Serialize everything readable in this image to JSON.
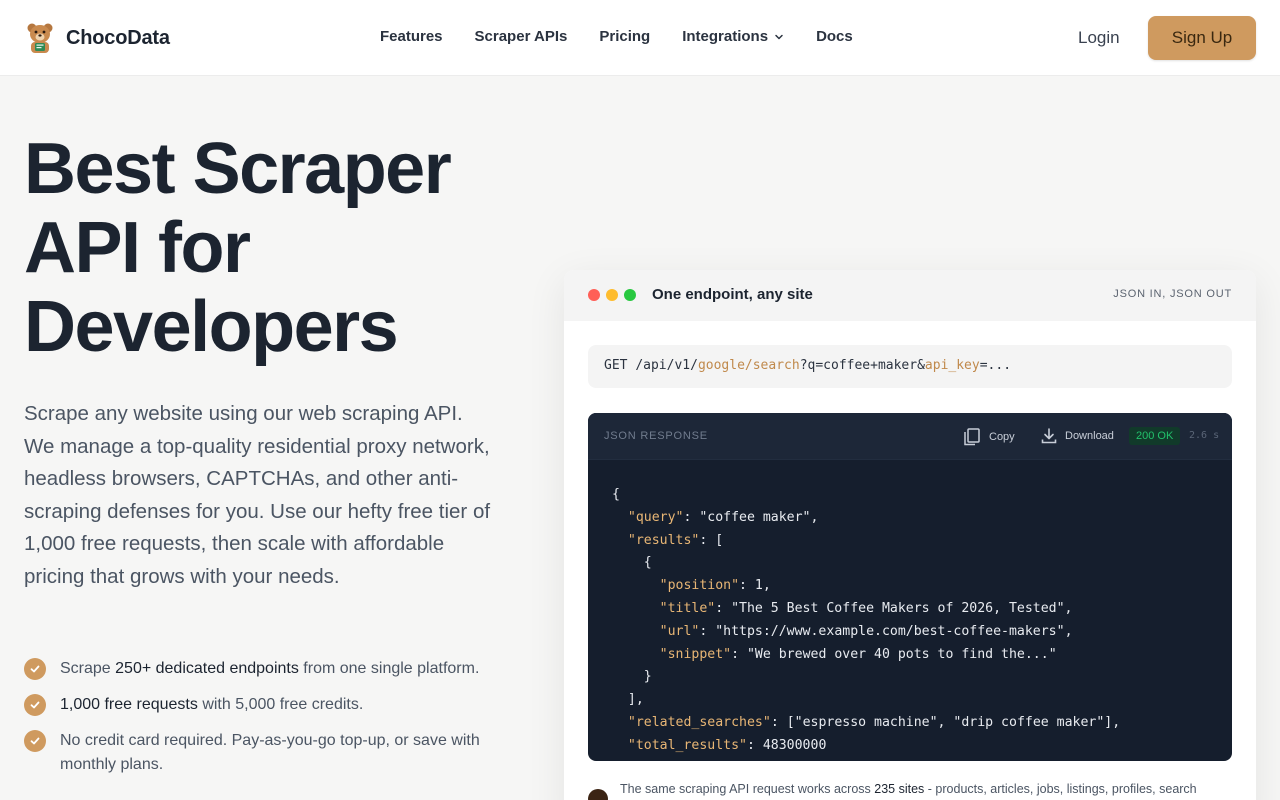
{
  "brand": {
    "name": "ChocoData",
    "logo_icon": "bear-mascot-icon"
  },
  "nav": {
    "items": [
      {
        "label": "Features"
      },
      {
        "label": "Scraper APIs"
      },
      {
        "label": "Pricing"
      },
      {
        "label": "Integrations",
        "has_dropdown": true
      },
      {
        "label": "Docs"
      }
    ],
    "login_label": "Login",
    "signup_label": "Sign Up"
  },
  "hero": {
    "title": "Best Scraper API for Developers",
    "description": "Scrape any website using our web scraping API. We manage a top-quality residential proxy network, headless browsers, CAPTCHAs, and other anti-scraping defenses for you. Use our hefty free tier of 1,000 free requests, then scale with affordable pricing that grows with your needs.",
    "features": [
      {
        "pre": "Scrape ",
        "bold": "250+ dedicated endpoints",
        "post": " from one single platform."
      },
      {
        "pre": "",
        "bold": "1,000 free requests",
        "post": " with 5,000 free credits."
      },
      {
        "pre": "No credit card required. Pay-as-you-go top-up, or save with monthly plans.",
        "bold": "",
        "post": ""
      }
    ]
  },
  "demo": {
    "title": "One endpoint, any site",
    "tag": "JSON IN, JSON OUT",
    "request": {
      "method": "GET",
      "path_prefix": "/api/v1/",
      "path_accent": "google/search",
      "query_prefix": "?q=coffee+maker&",
      "query_accent": "api_key",
      "query_suffix": "=..."
    },
    "response": {
      "label": "JSON RESPONSE",
      "copy_label": "Copy",
      "download_label": "Download",
      "status": "200 OK",
      "timing": "2.6 s",
      "lines": [
        [
          {
            "t": "{",
            "c": "s"
          }
        ],
        [
          {
            "t": "  ",
            "c": "s"
          },
          {
            "t": "\"query\"",
            "c": "k"
          },
          {
            "t": ": \"coffee maker\",",
            "c": "s"
          }
        ],
        [
          {
            "t": "  ",
            "c": "s"
          },
          {
            "t": "\"results\"",
            "c": "k"
          },
          {
            "t": ": [",
            "c": "s"
          }
        ],
        [
          {
            "t": "    {",
            "c": "s"
          }
        ],
        [
          {
            "t": "      ",
            "c": "s"
          },
          {
            "t": "\"position\"",
            "c": "k"
          },
          {
            "t": ": 1,",
            "c": "s"
          }
        ],
        [
          {
            "t": "      ",
            "c": "s"
          },
          {
            "t": "\"title\"",
            "c": "k"
          },
          {
            "t": ": \"The 5 Best Coffee Makers of 2026, Tested\",",
            "c": "s"
          }
        ],
        [
          {
            "t": "      ",
            "c": "s"
          },
          {
            "t": "\"url\"",
            "c": "k"
          },
          {
            "t": ": \"https://www.example.com/best-coffee-makers\",",
            "c": "s"
          }
        ],
        [
          {
            "t": "      ",
            "c": "s"
          },
          {
            "t": "\"snippet\"",
            "c": "k"
          },
          {
            "t": ": \"We brewed over 40 pots to find the...\"",
            "c": "s"
          }
        ],
        [
          {
            "t": "    }",
            "c": "s"
          }
        ],
        [
          {
            "t": "  ],",
            "c": "s"
          }
        ],
        [
          {
            "t": "  ",
            "c": "s"
          },
          {
            "t": "\"related_searches\"",
            "c": "k"
          },
          {
            "t": ": [\"espresso machine\", \"drip coffee maker\"],",
            "c": "s"
          }
        ],
        [
          {
            "t": "  ",
            "c": "s"
          },
          {
            "t": "\"total_results\"",
            "c": "k"
          },
          {
            "t": ": 48300000",
            "c": "s"
          }
        ]
      ]
    },
    "note": {
      "pre": "The same scraping API request works across ",
      "bold": "235 sites",
      "post": " - products, articles, jobs, listings, profiles, search"
    }
  },
  "colors": {
    "accent": "#cf9a5f",
    "code_bg": "#151e2d",
    "status_green": "#22c06b",
    "dot_red": "#ff5f57",
    "dot_yellow": "#febc2e",
    "dot_green": "#28c840"
  }
}
